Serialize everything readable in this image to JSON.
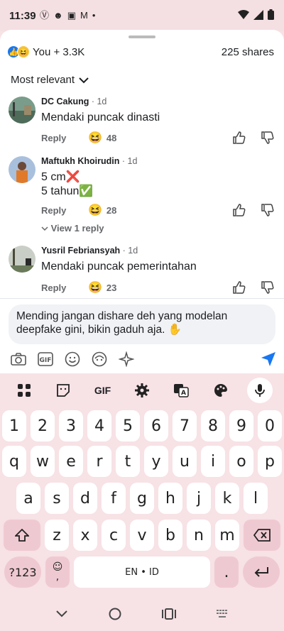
{
  "status_bar": {
    "time": "11:39",
    "notification_icons": [
      "Ⓥ",
      "☻",
      "▣",
      "M",
      "•"
    ]
  },
  "summary": {
    "reaction_count": "You + 3.3K",
    "shares": "225 shares"
  },
  "sort": {
    "label": "Most relevant"
  },
  "comments": [
    {
      "name": "DC Cakung",
      "time": " · 1d",
      "text": "Mendaki puncak dinasti",
      "reply": "Reply",
      "reactions": "48",
      "avatar_color": "#5d7a6a"
    },
    {
      "name": "Maftukh Khoirudin",
      "time": " · 1d",
      "text_line1": "5 cm❌",
      "text_line2": "5 tahun✅",
      "reply": "Reply",
      "reactions": "28",
      "avatar_color": "#8fa8c8"
    },
    {
      "name": "Yusril Febriansyah",
      "time": " · 1d",
      "text": "Mendaki puncak pemerintahan",
      "reply": "Reply",
      "reactions": "23",
      "avatar_color": "#7d8a78"
    }
  ],
  "view_reply": "View 1 reply",
  "compose": {
    "text": "Mending jangan dishare deh yang modelan deepfake gini, bikin gaduh aja. ✋"
  },
  "keyboard": {
    "toolbar_gif": "GIF",
    "row_numbers": [
      "1",
      "2",
      "3",
      "4",
      "5",
      "6",
      "7",
      "8",
      "9",
      "0"
    ],
    "row1": [
      "q",
      "w",
      "e",
      "r",
      "t",
      "y",
      "u",
      "i",
      "o",
      "p"
    ],
    "row2": [
      "a",
      "s",
      "d",
      "f",
      "g",
      "h",
      "j",
      "k",
      "l"
    ],
    "row3": [
      "z",
      "x",
      "c",
      "v",
      "b",
      "n",
      "m"
    ],
    "sym_key": "?123",
    "emoji_comma": ",",
    "space_label": "EN • ID",
    "period": "."
  },
  "colors": {
    "facebook_blue": "#1877f2",
    "keyboard_bg": "#f7e2e6",
    "special_key": "#efc9d1"
  }
}
